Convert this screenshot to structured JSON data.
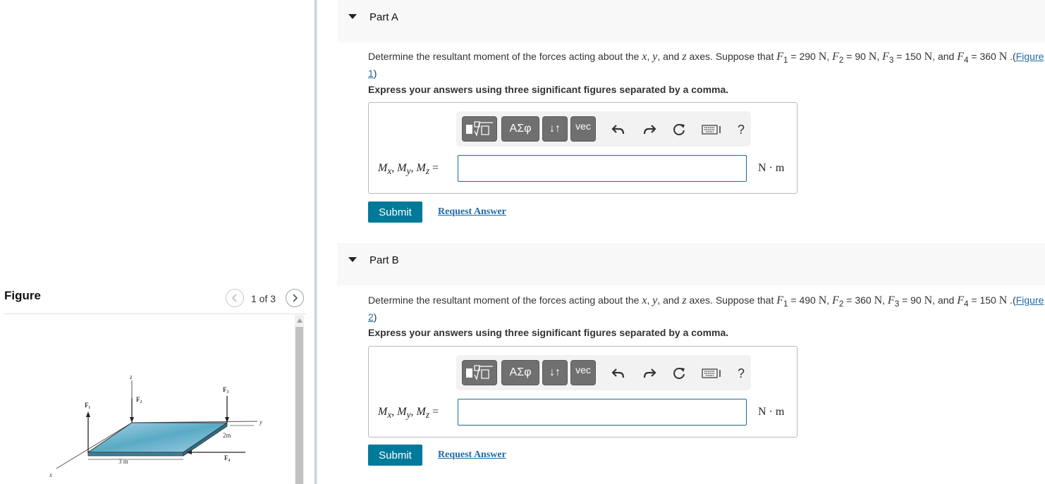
{
  "figure_panel": {
    "title": "Figure",
    "page_counter": "1 of 3",
    "diagram_labels": {
      "z": "z",
      "f1": "F₁",
      "f2": "F₂",
      "f3": "F₃",
      "f4": "F₄",
      "y": "y",
      "x": "x",
      "dim_2m": "2m",
      "dim_3m": "3 m"
    }
  },
  "parts": [
    {
      "title": "Part A",
      "question_prefix": "Determine the resultant moment of the forces acting about the",
      "axes": [
        "x",
        "y",
        "z"
      ],
      "question_mid": "axes. Suppose that",
      "f1_value": "290",
      "f2_value": "90",
      "f3_value": "150",
      "f4_value": "360",
      "figure_link": "Figure 1",
      "instruction": "Express your answers using three significant figures separated by a comma.",
      "input_label": "Mx, My, Mz =",
      "unit": "N · m",
      "input_value": "",
      "submit_label": "Submit",
      "request_label": "Request Answer"
    },
    {
      "title": "Part B",
      "question_prefix": "Determine the resultant moment of the forces acting about the",
      "axes": [
        "x",
        "y",
        "z"
      ],
      "question_mid": "axes. Suppose that",
      "f1_value": "490",
      "f2_value": "360",
      "f3_value": "90",
      "f4_value": "150",
      "figure_link": "Figure 2",
      "instruction": "Express your answers using three significant figures separated by a comma.",
      "input_label": "Mx, My, Mz =",
      "unit": "N · m",
      "input_value": "",
      "submit_label": "Submit",
      "request_label": "Request Answer"
    }
  ],
  "toolbar": {
    "templates_icon": "fraction-sqrt-icon",
    "greek_label": "ΑΣφ",
    "updown_label": "↓↑",
    "vec_label": "vec",
    "undo_icon": "undo-icon",
    "redo_icon": "redo-icon",
    "reset_icon": "reset-icon",
    "keyboard_icon": "keyboard-icon",
    "help_label": "?"
  },
  "colors": {
    "accent": "#007a9a",
    "link": "#1e6aa6",
    "toolbar_button": "#707070",
    "header_bg": "#f8f8f8"
  }
}
